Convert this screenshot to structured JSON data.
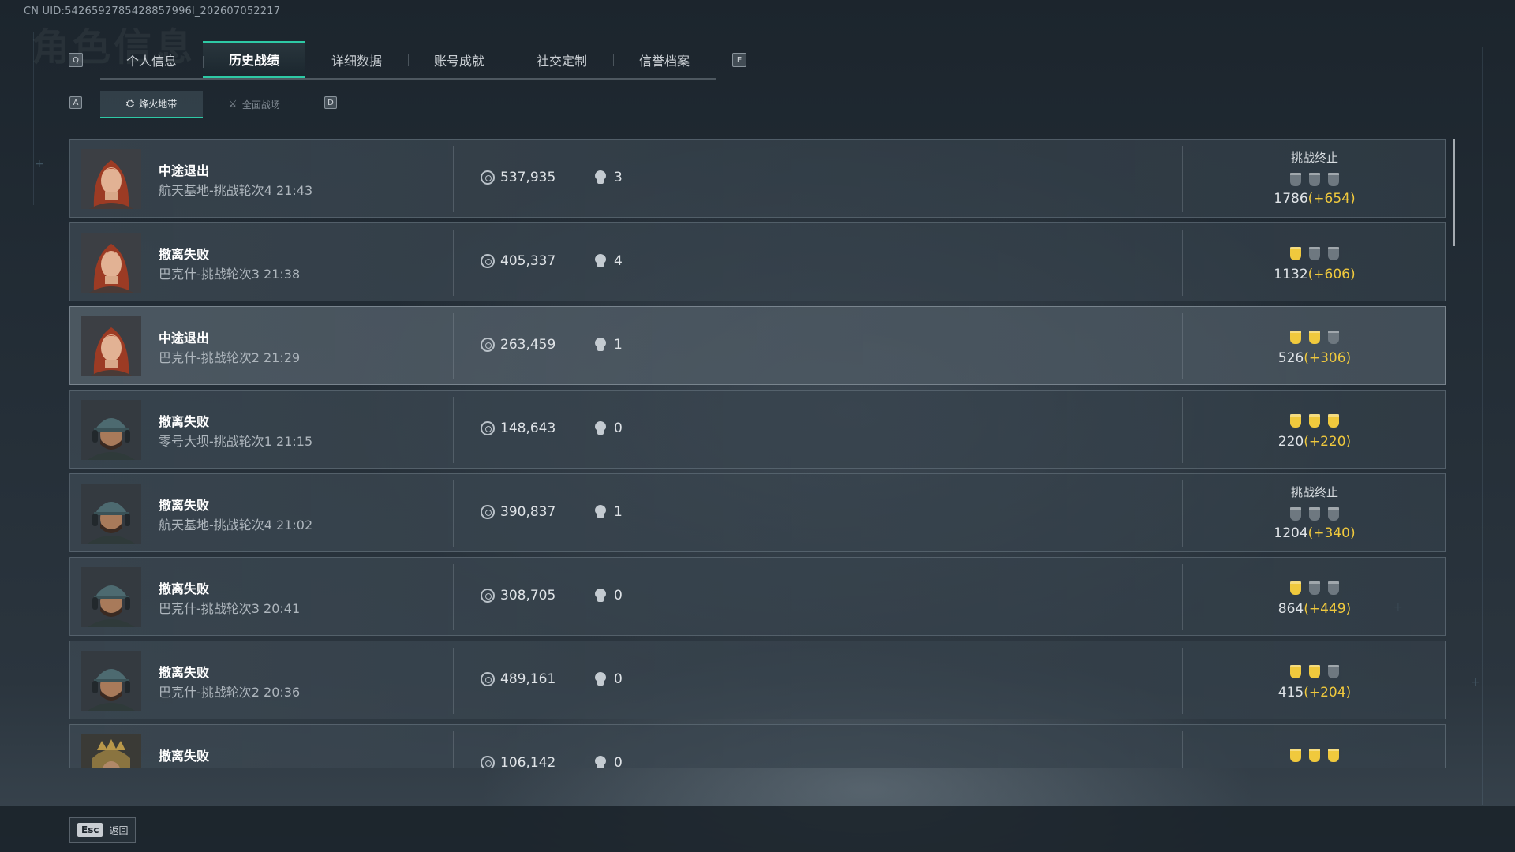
{
  "uid_text": "CN UID:5426592785428857996l_202607052217",
  "tabs": {
    "left_key": "Q",
    "right_key": "E",
    "items": [
      "个人信息",
      "历史战绩",
      "详细数据",
      "账号成就",
      "社交定制",
      "信誉档案"
    ],
    "active_index": 1
  },
  "subtabs": {
    "left_key": "A",
    "right_key": "D",
    "items": [
      {
        "label": "烽火地带",
        "icon": "hazard-zone-icon",
        "active": true
      },
      {
        "label": "全面战场",
        "icon": "warfare-icon",
        "active": false
      }
    ]
  },
  "colors": {
    "accent": "#2ec9a5",
    "gold": "#f0c93d"
  },
  "records": [
    {
      "status": "中途退出",
      "detail": "航天基地-挑战轮次4 21:43",
      "money": "537,935",
      "kills": "3",
      "terminated": "挑战终止",
      "shields_on": 0,
      "score": "1786",
      "gain": "(+654)",
      "avatar": "red-hair-female"
    },
    {
      "status": "撤离失败",
      "detail": "巴克什-挑战轮次3 21:38",
      "money": "405,337",
      "kills": "4",
      "terminated": "",
      "shields_on": 1,
      "score": "1132",
      "gain": "(+606)",
      "avatar": "red-hair-female"
    },
    {
      "status": "中途退出",
      "detail": "巴克什-挑战轮次2 21:29",
      "money": "263,459",
      "kills": "1",
      "terminated": "",
      "shields_on": 2,
      "score": "526",
      "gain": "(+306)",
      "avatar": "red-hair-female",
      "highlight": true
    },
    {
      "status": "撤离失败",
      "detail": "零号大坝-挑战轮次1 21:15",
      "money": "148,643",
      "kills": "0",
      "terminated": "",
      "shields_on": 3,
      "score": "220",
      "gain": "(+220)",
      "avatar": "cap-headset-male"
    },
    {
      "status": "撤离失败",
      "detail": "航天基地-挑战轮次4 21:02",
      "money": "390,837",
      "kills": "1",
      "terminated": "挑战终止",
      "shields_on": 0,
      "score": "1204",
      "gain": "(+340)",
      "avatar": "cap-headset-male"
    },
    {
      "status": "撤离失败",
      "detail": "巴克什-挑战轮次3 20:41",
      "money": "308,705",
      "kills": "0",
      "terminated": "",
      "shields_on": 1,
      "score": "864",
      "gain": "(+449)",
      "avatar": "cap-headset-male"
    },
    {
      "status": "撤离失败",
      "detail": "巴克什-挑战轮次2 20:36",
      "money": "489,161",
      "kills": "0",
      "terminated": "",
      "shields_on": 2,
      "score": "415",
      "gain": "(+204)",
      "avatar": "cap-headset-male"
    },
    {
      "status": "撤离失败",
      "detail": "",
      "money": "106,142",
      "kills": "0",
      "terminated": "",
      "shields_on": 3,
      "score": "",
      "gain": "",
      "avatar": "armored-helmet"
    }
  ],
  "footer": {
    "esc_key": "Esc",
    "esc_label": "返回"
  }
}
